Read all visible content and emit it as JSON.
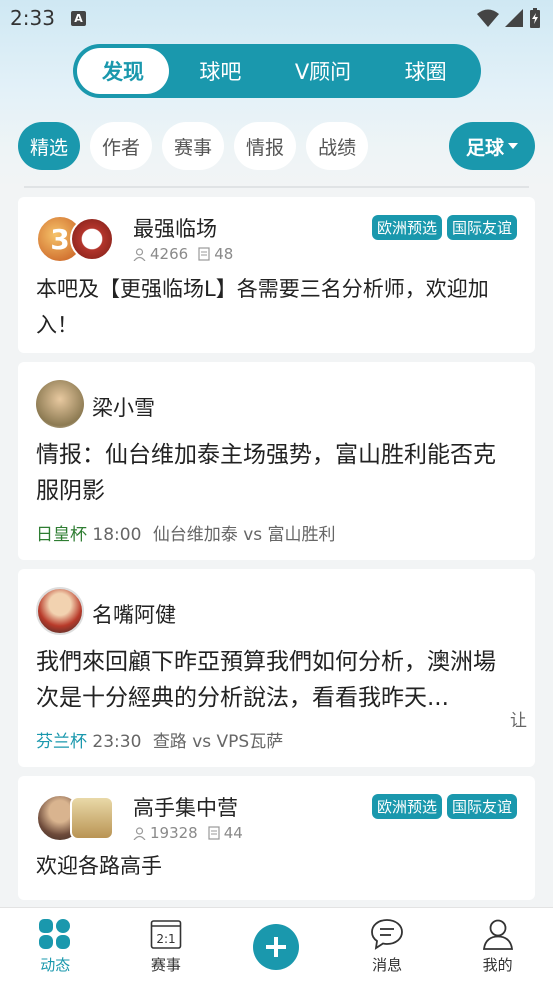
{
  "status": {
    "time": "2:33",
    "a_icon": "A"
  },
  "top_tabs": [
    "发现",
    "球吧",
    "V顾问",
    "球圈"
  ],
  "filters": [
    "精选",
    "作者",
    "赛事",
    "情报",
    "战绩"
  ],
  "sport_button": "足球",
  "cards": [
    {
      "title": "最强临场",
      "members": "4266",
      "posts": "48",
      "tags": [
        "欧洲预选",
        "国际友谊"
      ],
      "body": "本吧及【更强临场L】各需要三名分析师，欢迎加入！",
      "avatar_text": "3"
    },
    {
      "title": "梁小雪",
      "body": "情报：仙台维加泰主场强势，富山胜利能否克服阴影",
      "league": "日皇杯",
      "time": "18:00",
      "match": "仙台维加泰 vs 富山胜利"
    },
    {
      "title": "名嘴阿健",
      "body": "我們來回顧下昨亞預算我們如何分析，澳洲場次是十分經典的分析說法，看看我昨天...",
      "league": "芬兰杯",
      "time": "23:30",
      "match": "查路 vs VPS瓦萨",
      "side": "让"
    },
    {
      "title": "高手集中营",
      "members": "19328",
      "posts": "44",
      "tags": [
        "欧洲预选",
        "国际友谊"
      ],
      "body": "欢迎各路高手"
    }
  ],
  "bottom_nav": [
    "动态",
    "赛事",
    "",
    "消息",
    "我的"
  ],
  "match_icon_text": "2:1",
  "colors": {
    "accent": "#1a98ad",
    "league_green": "#2e7d32"
  }
}
